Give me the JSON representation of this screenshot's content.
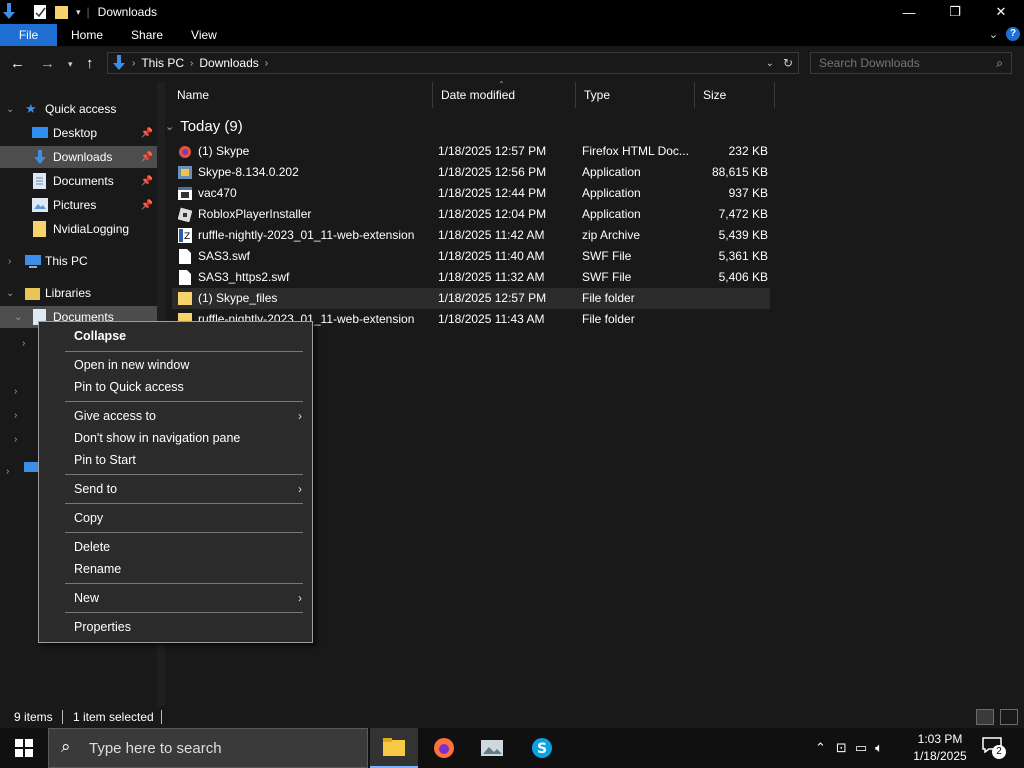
{
  "window": {
    "title": "Downloads",
    "controls": {
      "minimize": "—",
      "maximize": "❐",
      "close": "✕"
    }
  },
  "ribbon": {
    "tabs": [
      "File",
      "Home",
      "Share",
      "View"
    ]
  },
  "address": {
    "crumbs": [
      "This PC",
      "Downloads"
    ]
  },
  "search": {
    "placeholder": "Search Downloads"
  },
  "nav_pane": {
    "quick_access": "Quick access",
    "items": [
      {
        "label": "Desktop",
        "pinned": true
      },
      {
        "label": "Downloads",
        "pinned": true,
        "selected": true
      },
      {
        "label": "Documents",
        "pinned": true
      },
      {
        "label": "Pictures",
        "pinned": true
      },
      {
        "label": "NvidiaLogging",
        "pinned": false
      }
    ],
    "this_pc": "This PC",
    "libraries": "Libraries",
    "libraries_documents": "Documents"
  },
  "columns": [
    "Name",
    "Date modified",
    "Type",
    "Size"
  ],
  "group": {
    "label": "Today (9)"
  },
  "files": [
    {
      "name": "(1) Skype",
      "date": "1/18/2025 12:57 PM",
      "type": "Firefox HTML Doc...",
      "size": "232 KB",
      "icon": "firefox-html-icon"
    },
    {
      "name": "Skype-8.134.0.202",
      "date": "1/18/2025 12:56 PM",
      "type": "Application",
      "size": "88,615 KB",
      "icon": "installer-icon"
    },
    {
      "name": "vac470",
      "date": "1/18/2025 12:44 PM",
      "type": "Application",
      "size": "937 KB",
      "icon": "application-icon"
    },
    {
      "name": "RobloxPlayerInstaller",
      "date": "1/18/2025 12:04 PM",
      "type": "Application",
      "size": "7,472 KB",
      "icon": "roblox-icon"
    },
    {
      "name": "ruffle-nightly-2023_01_11-web-extension",
      "date": "1/18/2025 11:42 AM",
      "type": "zip Archive",
      "size": "5,439 KB",
      "icon": "zip-icon"
    },
    {
      "name": "SAS3.swf",
      "date": "1/18/2025 11:40 AM",
      "type": "SWF File",
      "size": "5,361 KB",
      "icon": "file-icon"
    },
    {
      "name": "SAS3_https2.swf",
      "date": "1/18/2025 11:32 AM",
      "type": "SWF File",
      "size": "5,406 KB",
      "icon": "file-icon"
    },
    {
      "name": "(1) Skype_files",
      "date": "1/18/2025 12:57 PM",
      "type": "File folder",
      "size": "",
      "icon": "folder-icon"
    },
    {
      "name": "ruffle-nightly-2023_01_11-web-extension",
      "date": "1/18/2025 11:43 AM",
      "type": "File folder",
      "size": "",
      "icon": "folder-icon"
    }
  ],
  "context_menu": {
    "items": [
      {
        "label": "Collapse",
        "bold": true
      },
      {
        "label": "Open in new window"
      },
      {
        "label": "Pin to Quick access"
      },
      {
        "label": "Give access to",
        "submenu": true
      },
      {
        "label": "Don't show in navigation pane"
      },
      {
        "label": "Pin to Start"
      },
      {
        "label": "Send to",
        "submenu": true
      },
      {
        "label": "Copy"
      },
      {
        "label": "Delete"
      },
      {
        "label": "Rename"
      },
      {
        "label": "New",
        "submenu": true
      },
      {
        "label": "Properties"
      }
    ]
  },
  "status": {
    "count": "9 items",
    "selected": "1 item selected"
  },
  "taskbar": {
    "search_placeholder": "Type here to search",
    "apps": [
      "file-explorer-icon",
      "firefox-icon",
      "photos-icon",
      "skype-icon"
    ],
    "time": "1:03 PM",
    "date": "1/18/2025",
    "notifications": "2"
  },
  "colors": {
    "accent": "#1e6fd1",
    "background": "#191919",
    "menu": "#2b2b2b"
  }
}
